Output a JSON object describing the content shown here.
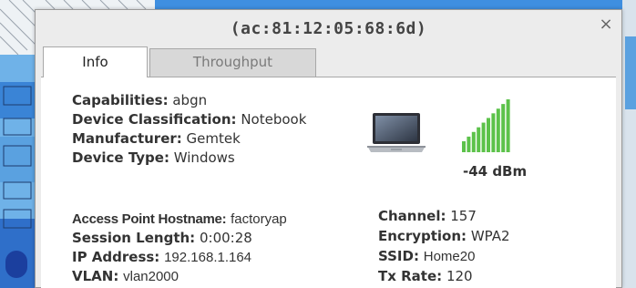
{
  "window": {
    "title": "(ac:81:12:05:68:6d)",
    "close_label": "×"
  },
  "tabs": [
    {
      "label": "Info",
      "active": true
    },
    {
      "label": "Throughput",
      "active": false
    }
  ],
  "device": {
    "capabilities_label": "Capabilities:",
    "capabilities_value": "abgn",
    "classification_label": "Device Classification:",
    "classification_value": "Notebook",
    "manufacturer_label": "Manufacturer:",
    "manufacturer_value": "Gemtek",
    "type_label": "Device Type:",
    "type_value": "Windows",
    "icon": "laptop-icon"
  },
  "signal": {
    "icon": "signal-strength-icon",
    "value": "-44 dBm",
    "bars_filled": 10,
    "bars_total": 10,
    "color": "#5cc24a"
  },
  "connection": {
    "ap_hostname_label": "Access Point Hostname:",
    "ap_hostname_value": "factoryap",
    "session_length_label": "Session Length:",
    "session_length_value": "0:00:28",
    "ip_address_label": "IP Address:",
    "ip_address_value": "192.168.1.164",
    "vlan_label": "VLAN:",
    "vlan_value": "vlan2000",
    "channel_label": "Channel:",
    "channel_value": "157",
    "encryption_label": "Encryption:",
    "encryption_value": "WPA2",
    "ssid_label": "SSID:",
    "ssid_value": "Home20",
    "tx_rate_label": "Tx Rate:",
    "tx_rate_value": "120"
  }
}
